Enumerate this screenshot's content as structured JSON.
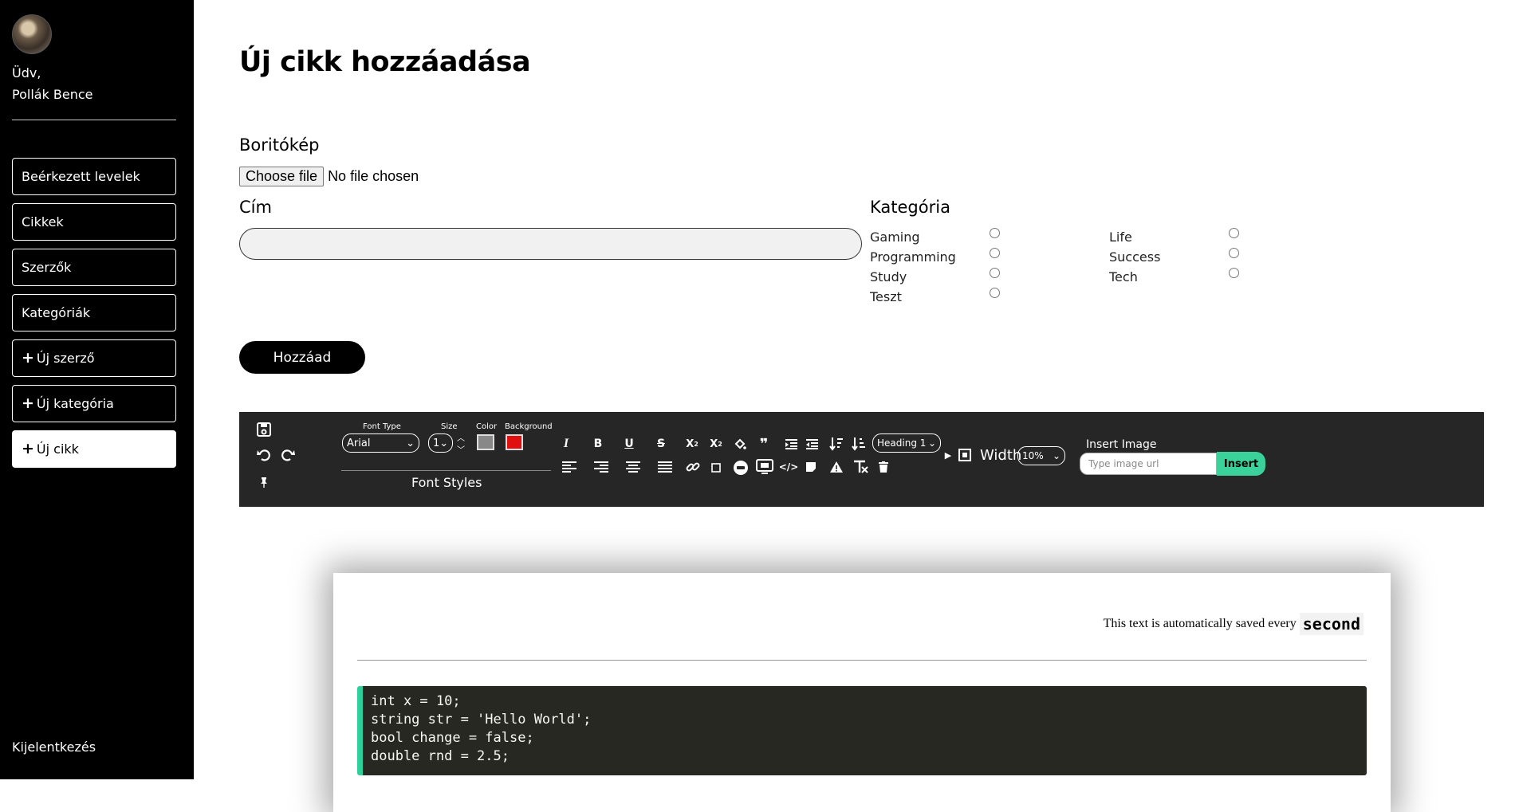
{
  "sidebar": {
    "greeting_line1": "Üdv,",
    "greeting_line2": "Pollák Bence",
    "nav": [
      {
        "label": "Beérkezett levelek"
      },
      {
        "label": "Cikkek"
      },
      {
        "label": "Szerzők"
      },
      {
        "label": "Kategóriák"
      },
      {
        "label": "Új szerző",
        "icon": "plus-icon"
      },
      {
        "label": "Új kategória",
        "icon": "plus-icon"
      },
      {
        "label": "Új cikk",
        "icon": "plus-icon",
        "active": true
      }
    ],
    "logout": "Kijelentkezés"
  },
  "form": {
    "page_title": "Új cikk hozzáadása",
    "cover_label": "Boritókép",
    "file_button": "Choose file",
    "file_status": "No file chosen",
    "title_label": "Cím",
    "title_value": "",
    "category_label": "Kategória",
    "categories_left": [
      "Gaming",
      "Programming",
      "Study",
      "Teszt"
    ],
    "categories_right": [
      "Life",
      "Success",
      "Tech"
    ],
    "submit": "Hozzáad"
  },
  "toolbar": {
    "font_type_label": "Font Type",
    "font_type_value": "Arial",
    "size_label": "Size",
    "size_value": "1",
    "color_label": "Color",
    "background_label": "Background",
    "font_styles": "Font Styles",
    "heading_value": "Heading 1",
    "width_label": "Width",
    "width_value": "10%",
    "insert_image_label": "Insert Image",
    "insert_placeholder": "Type image url",
    "insert_button": "Insert",
    "color_swatch": "#888888",
    "background_swatch": "#e01010"
  },
  "editor": {
    "autosave_text": "This text is automatically saved every",
    "autosave_unit": "second",
    "code_lines": [
      "int x = 10;",
      "string str = 'Hello World';",
      "bool change = false;",
      "double rnd = 2.5;"
    ]
  }
}
